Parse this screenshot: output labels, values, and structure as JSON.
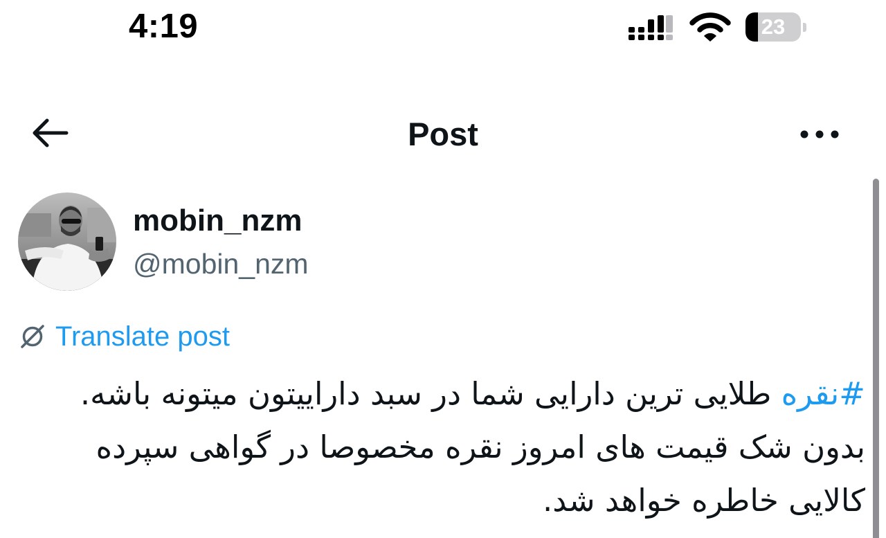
{
  "status_bar": {
    "time": "4:19",
    "battery_level": "23",
    "battery_fraction": 0.23,
    "icons": [
      "cellular-signal-icon",
      "wifi-icon",
      "battery-icon"
    ]
  },
  "header": {
    "title": "Post",
    "back_icon": "back-arrow-icon",
    "more_icon": "more-options-icon"
  },
  "post": {
    "author": {
      "display_name": "mobin_nzm",
      "handle": "@mobin_nzm"
    },
    "translate_label": "Translate post",
    "hashtag": "#نقره",
    "text_after_hashtag": " طلایی ترین دارایی شما در سبد داراییتون میتونه باشه. بدون شک قیمت های امروز نقره مخصوصا در گواهی سپرده کالایی خاطره خواهد شد."
  },
  "colors": {
    "link": "#1d9bf0",
    "text": "#0f1419",
    "secondary": "#536471"
  }
}
